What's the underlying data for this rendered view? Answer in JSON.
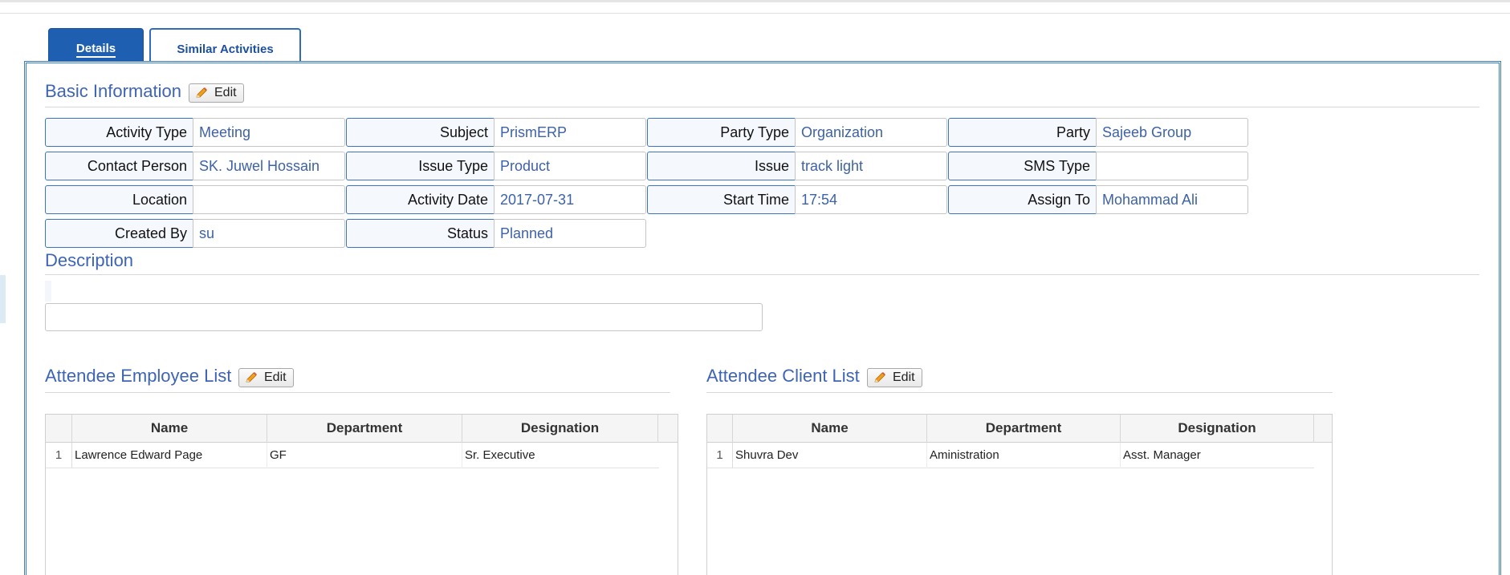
{
  "tabs": [
    {
      "label": "Details"
    },
    {
      "label": "Similar Activities"
    }
  ],
  "basic_info": {
    "title": "Basic Information",
    "edit_label": "Edit",
    "fields": [
      {
        "label": "Activity Type",
        "value": "Meeting"
      },
      {
        "label": "Subject",
        "value": "PrismERP"
      },
      {
        "label": "Party Type",
        "value": "Organization"
      },
      {
        "label": "Party",
        "value": "Sajeeb Group"
      },
      {
        "label": "Contact Person",
        "value": "SK. Juwel Hossain"
      },
      {
        "label": "Issue Type",
        "value": "Product"
      },
      {
        "label": "Issue",
        "value": "track light"
      },
      {
        "label": "SMS Type",
        "value": ""
      },
      {
        "label": "Location",
        "value": ""
      },
      {
        "label": "Activity Date",
        "value": "2017-07-31"
      },
      {
        "label": "Start Time",
        "value": "17:54"
      },
      {
        "label": "Assign To",
        "value": "Mohammad Ali"
      },
      {
        "label": "Created By",
        "value": "su"
      },
      {
        "label": "Status",
        "value": "Planned"
      }
    ]
  },
  "description": {
    "title": "Description",
    "value": ""
  },
  "employee_list": {
    "title": "Attendee Employee List",
    "edit_label": "Edit",
    "columns": [
      "Name",
      "Department",
      "Designation"
    ],
    "rows": [
      {
        "num": "1",
        "name": "Lawrence Edward Page",
        "department": "GF",
        "designation": "Sr. Executive"
      }
    ]
  },
  "client_list": {
    "title": "Attendee Client List",
    "edit_label": "Edit",
    "columns": [
      "Name",
      "Department",
      "Designation"
    ],
    "rows": [
      {
        "num": "1",
        "name": "Shuvra Dev",
        "department": "Aministration",
        "designation": "Asst. Manager"
      }
    ]
  },
  "colors": {
    "accent": "#1f5fb2",
    "section_title": "#3e64b4",
    "value_text": "#3d62a8",
    "label_border": "#3a74c2"
  }
}
